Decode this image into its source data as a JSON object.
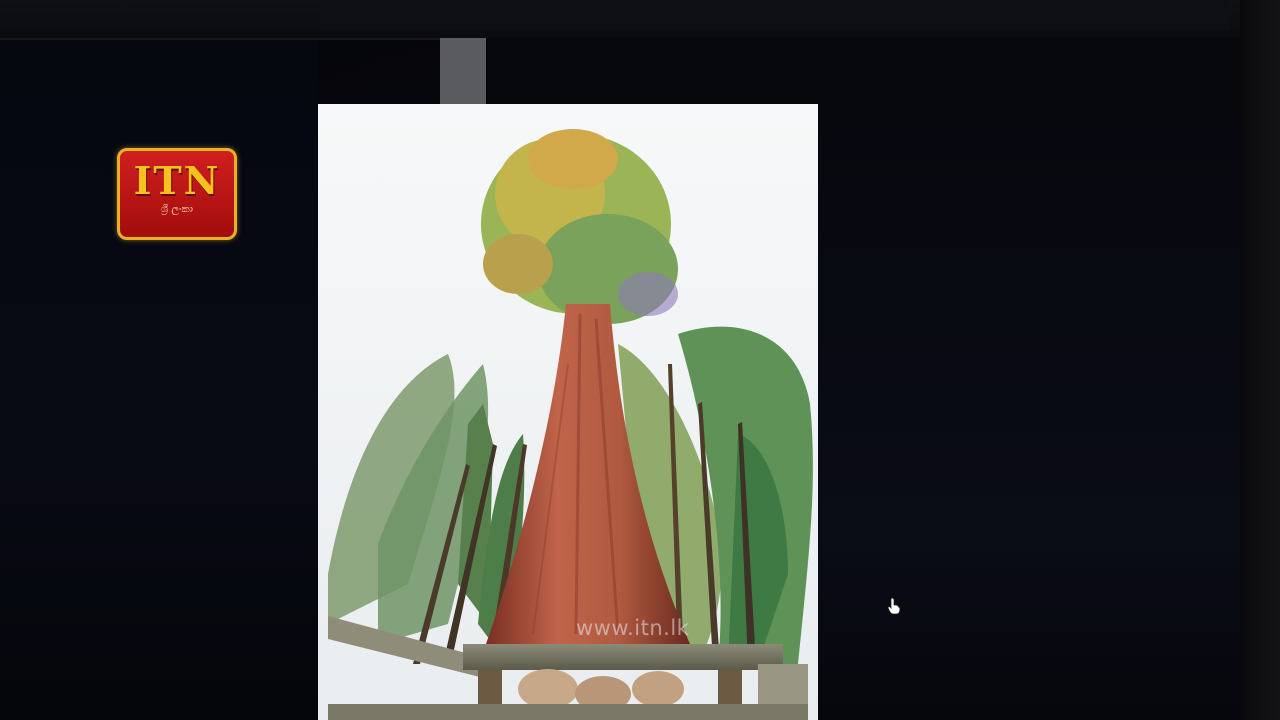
{
  "channel_logo": {
    "name": "ITN",
    "tagline": "ශ්‍රී ලංකා"
  },
  "photo": {
    "subject": "giant-sequoia-tree",
    "watermark": "www.itn.lk"
  },
  "colors": {
    "logo_red": "#c01616",
    "logo_gold": "#f6c21f",
    "trunk": "#b5533a",
    "sky": "#f2f4f6"
  },
  "icons": {
    "cursor": "hand-pointer-icon"
  }
}
